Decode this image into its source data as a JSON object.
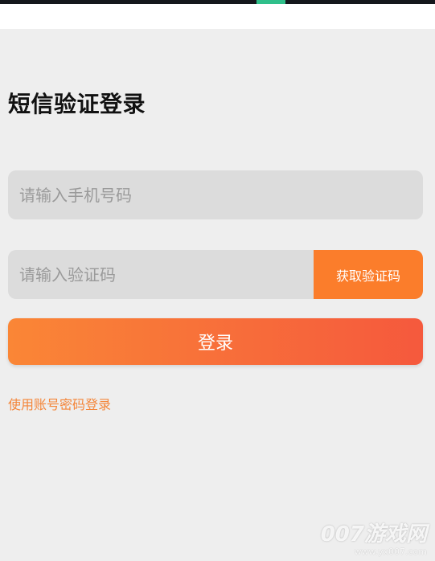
{
  "page": {
    "title": "短信验证登录"
  },
  "form": {
    "phone_placeholder": "请输入手机号码",
    "phone_value": "",
    "code_placeholder": "请输入验证码",
    "code_value": "",
    "get_code_label": "获取验证码",
    "login_label": "登录",
    "account_login_link": "使用账号密码登录"
  },
  "watermark": {
    "brand": "007游戏网",
    "url": "www.yx007.com"
  },
  "colors": {
    "accent": "#fb7d2b",
    "gradient_start": "#fa8636",
    "gradient_end": "#f5593d",
    "link": "#f4863a",
    "background": "#eeeeee",
    "field_bg": "#dcdcdc"
  }
}
